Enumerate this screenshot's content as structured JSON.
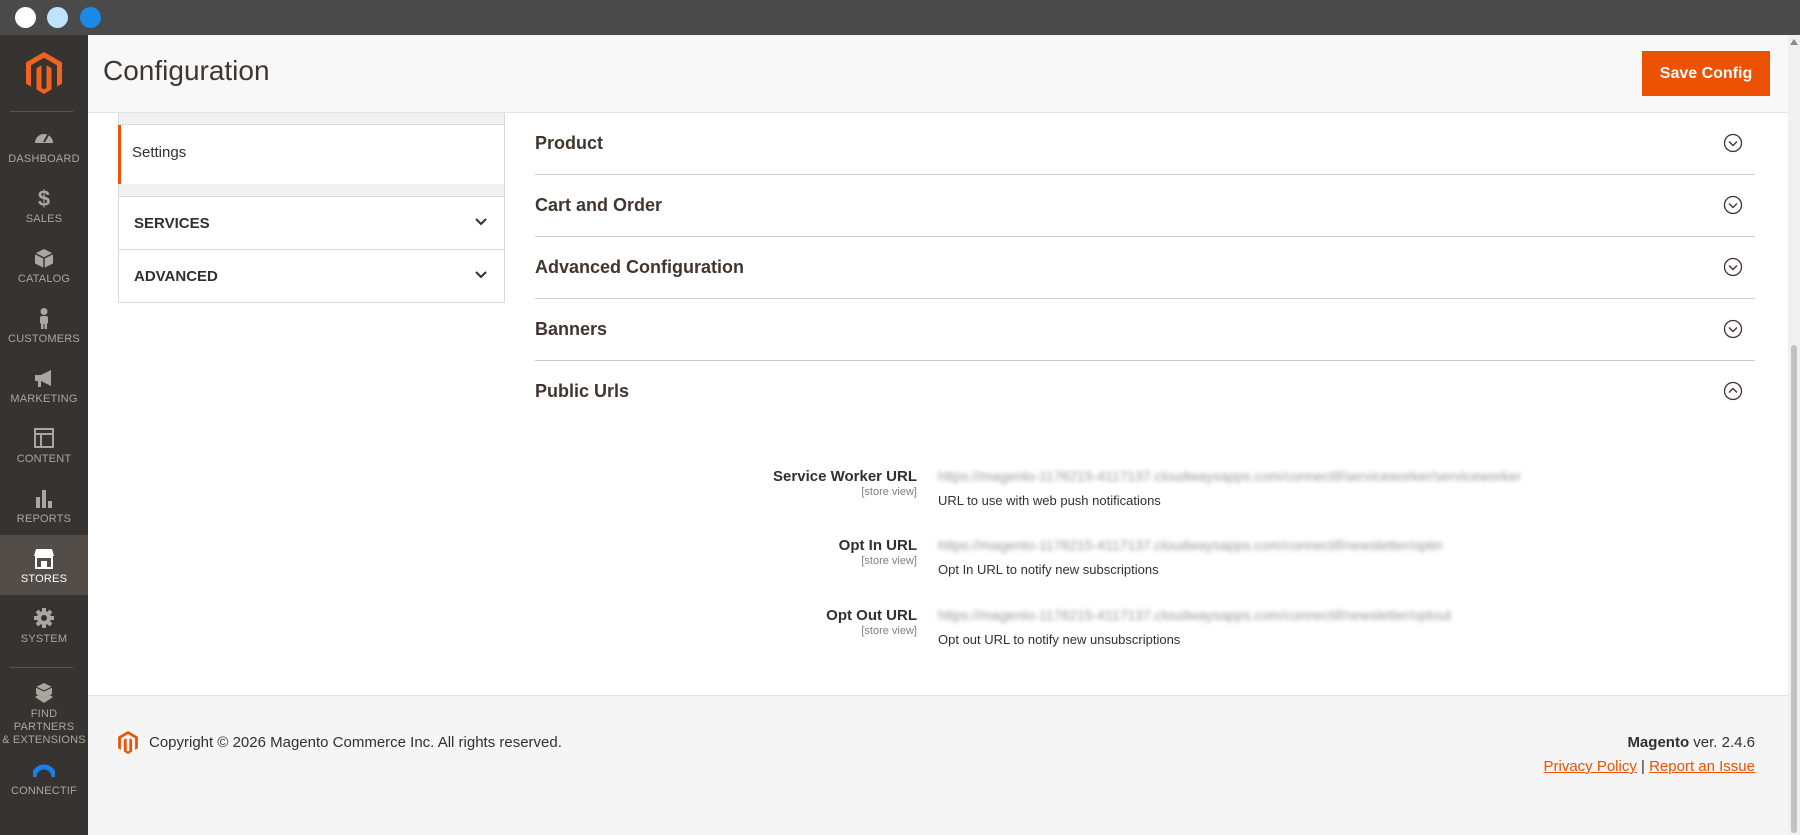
{
  "window": {
    "controls": [
      "close",
      "minimize",
      "zoom"
    ]
  },
  "admin_nav": {
    "items": [
      {
        "label": "DASHBOARD",
        "icon": "dashboard-icon",
        "active": false
      },
      {
        "label": "SALES",
        "icon": "dollar-icon",
        "active": false
      },
      {
        "label": "CATALOG",
        "icon": "box-icon",
        "active": false
      },
      {
        "label": "CUSTOMERS",
        "icon": "person-icon",
        "active": false
      },
      {
        "label": "MARKETING",
        "icon": "megaphone-icon",
        "active": false
      },
      {
        "label": "CONTENT",
        "icon": "layout-icon",
        "active": false
      },
      {
        "label": "REPORTS",
        "icon": "bar-chart-icon",
        "active": false
      },
      {
        "label": "STORES",
        "icon": "store-icon",
        "active": true
      },
      {
        "label": "SYSTEM",
        "icon": "gear-icon",
        "active": false
      },
      {
        "label": "FIND PARTNERS & EXTENSIONS",
        "label_line1": "FIND PARTNERS",
        "label_line2": "& EXTENSIONS",
        "icon": "cubes-icon",
        "active": false
      },
      {
        "label": "CONNECTIF",
        "icon": "connectif-icon",
        "active": false
      }
    ]
  },
  "header": {
    "title": "Configuration",
    "save_label": "Save Config"
  },
  "config_tabs": {
    "active_item": "Settings",
    "groups": [
      {
        "label": "SERVICES"
      },
      {
        "label": "ADVANCED"
      }
    ]
  },
  "sections": [
    {
      "title": "Product",
      "expanded": false
    },
    {
      "title": "Cart and Order",
      "expanded": false
    },
    {
      "title": "Advanced Configuration",
      "expanded": false
    },
    {
      "title": "Banners",
      "expanded": false
    },
    {
      "title": "Public Urls",
      "expanded": true
    }
  ],
  "public_urls": {
    "fields": [
      {
        "label": "Service Worker URL",
        "scope": "[store view]",
        "value": "https://magento-1176215-4117137.cloudwaysapps.com/connectif/serviceworker/serviceworker",
        "note": "URL to use with web push notifications"
      },
      {
        "label": "Opt In URL",
        "scope": "[store view]",
        "value": "https://magento-1176215-4117137.cloudwaysapps.com/connectif/newsletter/optin",
        "note": "Opt In URL to notify new subscriptions"
      },
      {
        "label": "Opt Out URL",
        "scope": "[store view]",
        "value": "https://magento-1176215-4117137.cloudwaysapps.com/connectif/newsletter/optout",
        "note": "Opt out URL to notify new unsubscriptions"
      }
    ]
  },
  "footer": {
    "copyright": "Copyright © 2026 Magento Commerce Inc. All rights reserved.",
    "brand": "Magento",
    "version": "ver. 2.4.6",
    "privacy_link": "Privacy Policy",
    "separator": "|",
    "report_link": "Report an Issue"
  },
  "colors": {
    "accent": "#eb5202",
    "nav_bg": "#373330",
    "nav_active_bg": "#524d49",
    "page_bg": "#ffffff",
    "footer_bg": "#f5f5f5"
  }
}
